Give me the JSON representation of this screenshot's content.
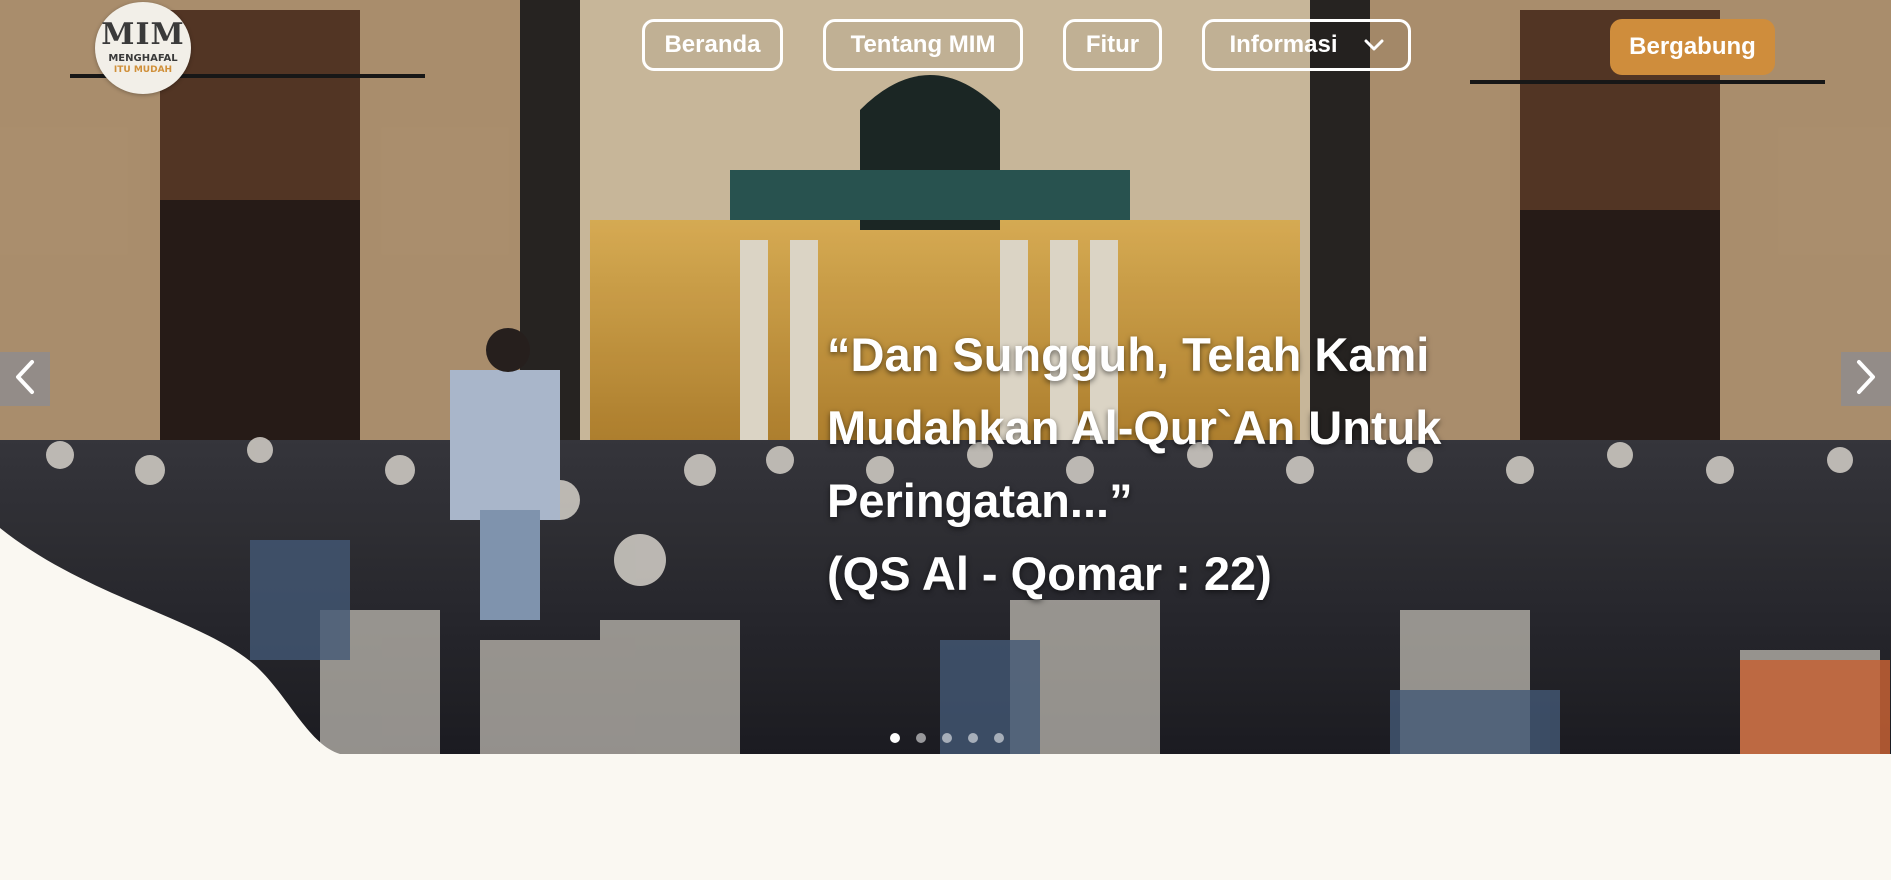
{
  "brand": {
    "logo_mark": "MIM",
    "logo_line1": "MENGHAFAL",
    "logo_line2": "ITU MUDAH"
  },
  "nav": {
    "items": [
      {
        "label": "Beranda"
      },
      {
        "label": "Tentang MIM"
      },
      {
        "label": "Fitur"
      },
      {
        "label": "Informasi",
        "icon": "chevron-down-icon"
      }
    ],
    "join_label": "Bergabung"
  },
  "hero": {
    "quote_lines": [
      "“Dan Sungguh, Telah Kami",
      "Mudahkan Al-Qur`An Untuk",
      "Peringatan...”",
      "(QS Al - Qomar : 22)"
    ],
    "slides_count": 5,
    "active_slide": 1,
    "prev_icon": "chevron-left-icon",
    "next_icon": "chevron-right-icon"
  },
  "colors": {
    "accent": "#cf8d3c",
    "background": "#faf8f2",
    "text_on_image": "#ffffff"
  }
}
